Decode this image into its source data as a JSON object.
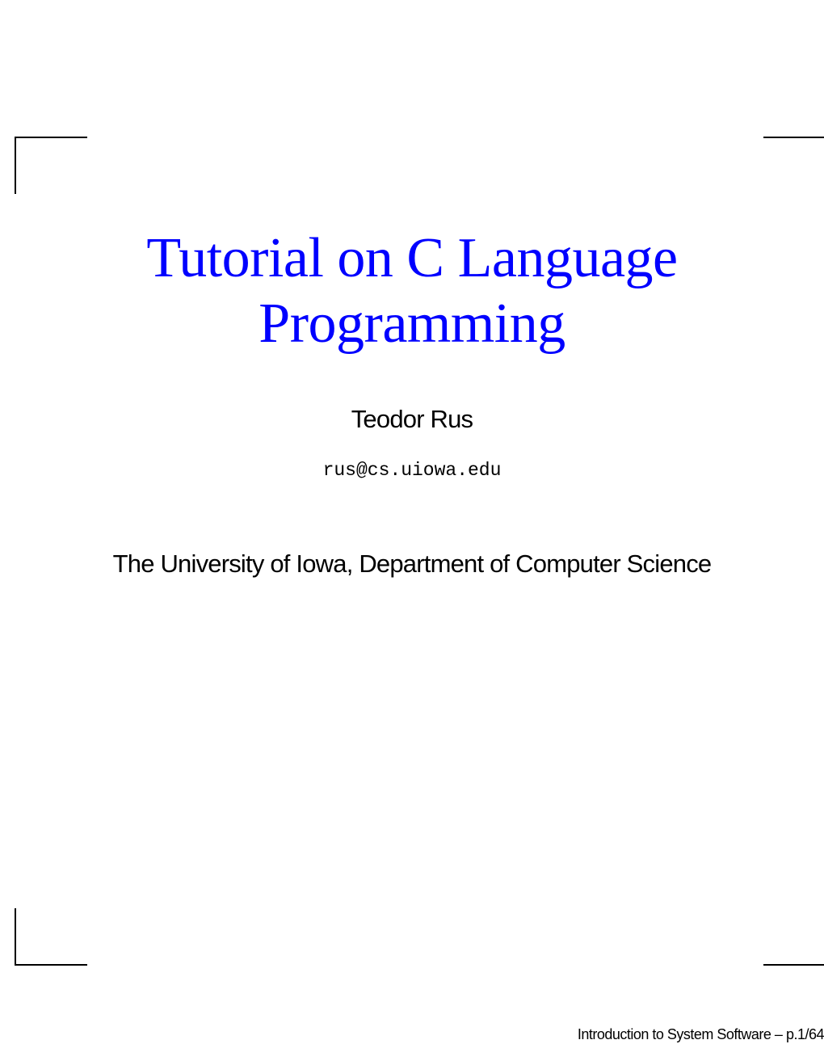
{
  "slide": {
    "title_line1": "Tutorial on C Language",
    "title_line2": "Programming",
    "author": "Teodor Rus",
    "email": "rus@cs.uiowa.edu",
    "affiliation": "The University of Iowa, Department of Computer Science",
    "footer": "Introduction to System Software – p.1/64"
  }
}
